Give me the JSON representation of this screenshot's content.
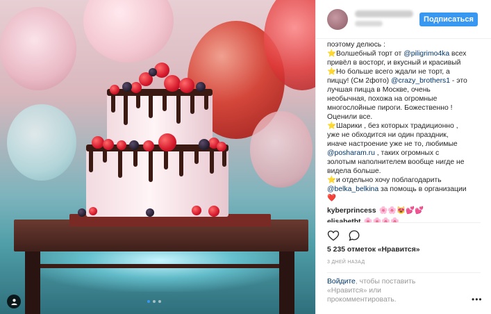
{
  "post": {
    "photo": {
      "alt_icons": [
        "tag-icon"
      ],
      "carousel_dots": 3,
      "carousel_active": 1
    },
    "header": {
      "follow_label": "Подписаться"
    },
    "caption": {
      "lines": [
        {
          "parts": [
            {
              "t": "поэтому делюсь :"
            }
          ]
        },
        {
          "parts": [
            {
              "t": "⭐",
              "c": "star"
            },
            {
              "t": "Волшебный торт от "
            },
            {
              "t": "@piligrimo4ka",
              "c": "mention"
            },
            {
              "t": " всех"
            }
          ]
        },
        {
          "parts": [
            {
              "t": "привёл в восторг, и вкусный и красивый"
            }
          ]
        },
        {
          "parts": [
            {
              "t": "⭐",
              "c": "star"
            },
            {
              "t": "Но больше всего ждали не торт, а"
            }
          ]
        },
        {
          "parts": [
            {
              "t": "пиццу! (См 2фото) "
            },
            {
              "t": "@crazy_brothers1",
              "c": "mention"
            },
            {
              "t": " - это"
            }
          ]
        },
        {
          "parts": [
            {
              "t": "лучшая пицца в Москве, очень"
            }
          ]
        },
        {
          "parts": [
            {
              "t": "необычная, похожа на огромные"
            }
          ]
        },
        {
          "parts": [
            {
              "t": "многослойные пироги. Божественно !"
            }
          ]
        },
        {
          "parts": [
            {
              "t": "Оценили все."
            }
          ]
        },
        {
          "parts": [
            {
              "t": "⭐",
              "c": "star"
            },
            {
              "t": "Шарики , без которых традиционно ,"
            }
          ]
        },
        {
          "parts": [
            {
              "t": "уже не обходится ни один праздник,"
            }
          ]
        },
        {
          "parts": [
            {
              "t": "иначе настроение уже не то, любимые"
            }
          ]
        },
        {
          "parts": [
            {
              "t": "@posharam.ru",
              "c": "mention"
            },
            {
              "t": " , таких огромных с"
            }
          ]
        },
        {
          "parts": [
            {
              "t": "золотым наполнителем вообще нигде не"
            }
          ]
        },
        {
          "parts": [
            {
              "t": "видела больше."
            }
          ]
        },
        {
          "parts": [
            {
              "t": "⭐",
              "c": "star"
            },
            {
              "t": "и отдельно хочу поблагодарить"
            }
          ]
        },
        {
          "parts": [
            {
              "t": "@belka_belkina",
              "c": "mention"
            },
            {
              "t": " за помощь в организации"
            }
          ]
        },
        {
          "parts": [
            {
              "t": "❤️",
              "c": "heart-red"
            }
          ]
        }
      ]
    },
    "comments": [
      {
        "user": "kyberprincess",
        "text": "🌸🌸😻💕💕"
      },
      {
        "user": "elisabetht",
        "text": "🌸🌸🌸🌸"
      }
    ],
    "likes_text": "5 235 отметок «Нравится»",
    "time_text": "3 ДНЕЙ НАЗАД",
    "login": {
      "link_text": "Войдите",
      "rest_text": ", чтобы поставить «Нравится» или прокомментировать."
    },
    "more_label": "•••"
  },
  "colors": {
    "accent": "#3897f0",
    "link": "#003569",
    "muted": "#999999"
  }
}
